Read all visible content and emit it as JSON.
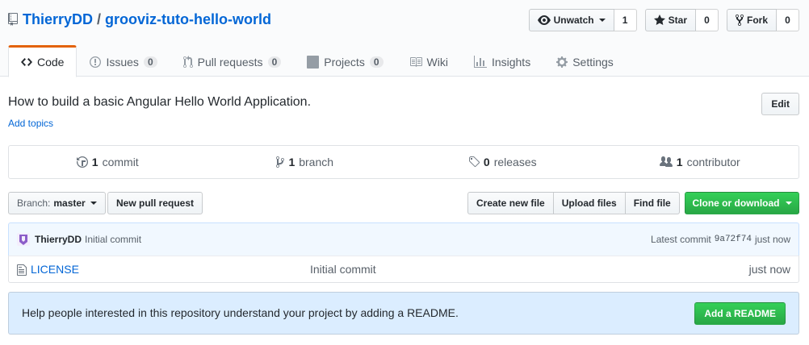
{
  "repo": {
    "owner": "ThierryDD",
    "separator": "/",
    "name": "grooviz-tuto-hello-world"
  },
  "actions": {
    "watch_label": "Unwatch",
    "watch_count": "1",
    "star_label": "Star",
    "star_count": "0",
    "fork_label": "Fork",
    "fork_count": "0"
  },
  "nav": {
    "code": "Code",
    "issues": "Issues",
    "issues_count": "0",
    "pulls": "Pull requests",
    "pulls_count": "0",
    "projects": "Projects",
    "projects_count": "0",
    "wiki": "Wiki",
    "insights": "Insights",
    "settings": "Settings"
  },
  "about": {
    "description": "How to build a basic Angular Hello World Application.",
    "add_topics": "Add topics",
    "edit": "Edit"
  },
  "summary": {
    "commits_num": "1",
    "commits_label": "commit",
    "branches_num": "1",
    "branches_label": "branch",
    "releases_num": "0",
    "releases_label": "releases",
    "contributors_num": "1",
    "contributors_label": "contributor"
  },
  "filenav": {
    "branch_prefix": "Branch:",
    "branch_name": "master",
    "new_pr": "New pull request",
    "create_file": "Create new file",
    "upload_files": "Upload files",
    "find_file": "Find file",
    "clone": "Clone or download"
  },
  "commit": {
    "author": "ThierryDD",
    "message": "Initial commit",
    "latest_label": "Latest commit",
    "sha": "9a72f74",
    "age": "just now"
  },
  "files": [
    {
      "name": "LICENSE",
      "message": "Initial commit",
      "age": "just now"
    }
  ],
  "readme": {
    "prompt": "Help people interested in this repository understand your project by adding a README.",
    "button": "Add a README"
  },
  "colors": {
    "link": "#0366d6",
    "nav_selected_accent": "#e36209",
    "primary_green": "#28a745",
    "commit_bg": "#f1f8ff",
    "readme_bg": "#dbedff"
  }
}
